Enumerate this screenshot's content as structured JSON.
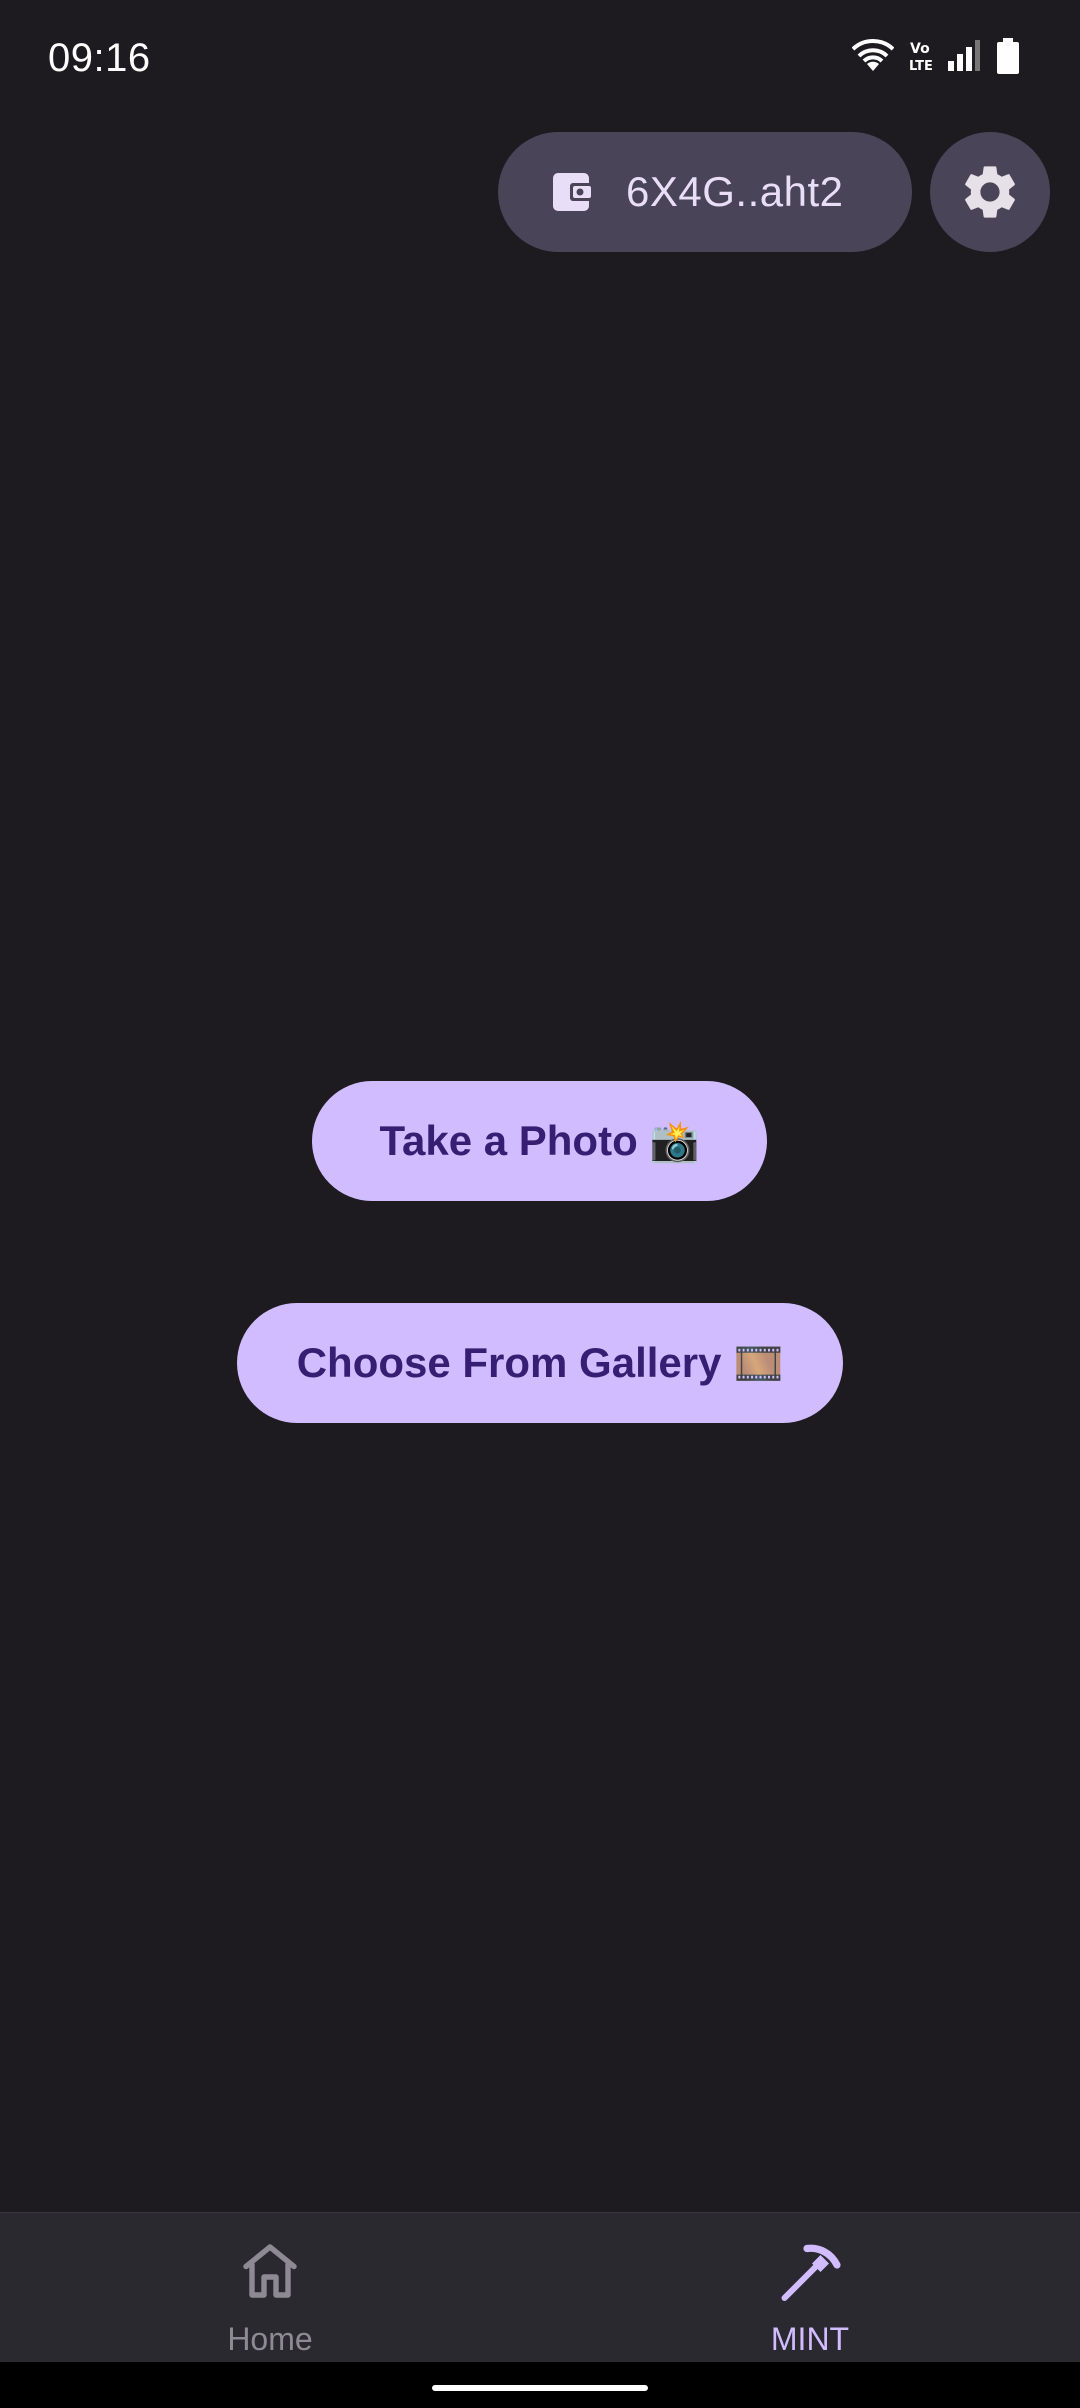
{
  "status_bar": {
    "time": "09:16",
    "icons": [
      "wifi-icon",
      "volte-icon",
      "signal-icon",
      "battery-icon"
    ]
  },
  "header": {
    "wallet_address": "6X4G..aht2",
    "wallet_icon": "wallet-icon",
    "settings_icon": "gear-icon"
  },
  "actions": {
    "take_photo": "Take a Photo",
    "take_photo_emoji": "📸",
    "choose_gallery": "Choose From Gallery",
    "choose_gallery_emoji": "🎞️"
  },
  "nav": {
    "items": [
      {
        "label": "Home",
        "icon": "home-icon",
        "active": false
      },
      {
        "label": "MINT",
        "icon": "pickaxe-icon",
        "active": true
      }
    ]
  },
  "colors": {
    "background": "#1d1b20",
    "pill": "#4a4458",
    "primary": "#d0bcff",
    "on_primary": "#381e72",
    "nav_bg": "#2b2930",
    "nav_inactive": "#8e8a94"
  }
}
